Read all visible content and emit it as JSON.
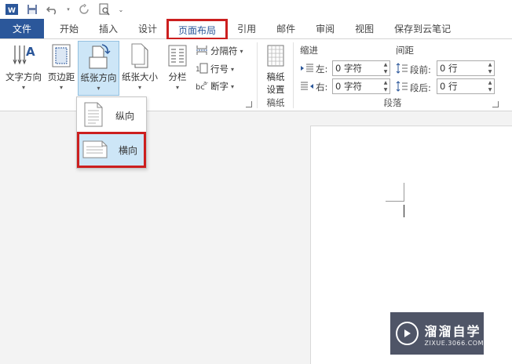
{
  "tabs": {
    "file": "文件",
    "home": "开始",
    "insert": "插入",
    "design": "设计",
    "layout": "页面布局",
    "references": "引用",
    "mailings": "邮件",
    "review": "审阅",
    "view": "视图",
    "cloud": "保存到云笔记"
  },
  "ribbon": {
    "page_setup": {
      "text_direction": "文字方向",
      "margins": "页边距",
      "orientation": "纸张方向",
      "size": "纸张大小",
      "columns": "分栏",
      "breaks": "分隔符",
      "line_numbers": "行号",
      "hyphenation": "断字"
    },
    "draft": {
      "button_line1": "稿纸",
      "button_line2": "设置",
      "group_label": "稿纸"
    },
    "paragraph": {
      "indent_title": "缩进",
      "spacing_title": "间距",
      "left_label": "左:",
      "right_label": "右:",
      "before_label": "段前:",
      "after_label": "段后:",
      "left_value": "0 字符",
      "right_value": "0 字符",
      "before_value": "0 行",
      "after_value": "0 行",
      "group_label": "段落"
    }
  },
  "dropdown": {
    "portrait": "纵向",
    "landscape": "横向"
  },
  "watermark": {
    "title": "溜溜自学",
    "url": "ZIXUE.3066.COM"
  },
  "colors": {
    "accent": "#2b579a",
    "highlight": "#cc1f1f",
    "selected": "#cde6f7"
  }
}
